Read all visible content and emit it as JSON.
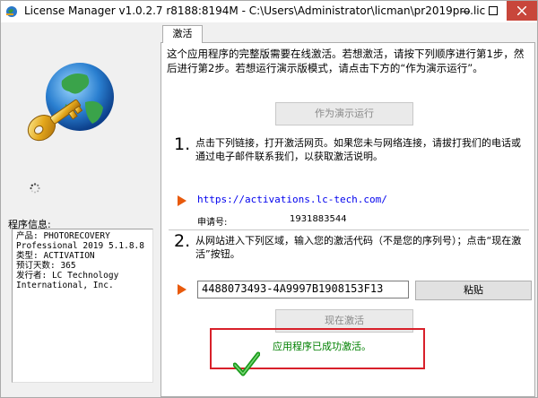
{
  "window": {
    "title": "License Manager v1.0.2.7 r8188:8194M - C:\\Users\\Administrator\\licman\\pr2019pro.lic",
    "controls": [
      "minimize",
      "maximize",
      "close"
    ]
  },
  "left": {
    "logo_icon": "globe-key-icon",
    "info_label": "程序信息:",
    "info_text": "产品: PHOTORECOVERY\nProfessional 2019 5.1.8.8\n类型: ACTIVATION\n预订天数: 365\n发行者: LC Technology\nInternational, Inc."
  },
  "tab": {
    "label": "激活"
  },
  "intro": "这个应用程序的完整版需要在线激活。若想激活，请按下列顺序进行第1步，然后进行第2步。若想运行演示版模式，请点击下方的“作为演示运行”。",
  "demo_button": "作为演示运行",
  "step1": {
    "number": "1.",
    "text": "点击下列链接，打开激活网页。如果您未与网络连接，请拔打我们的电话或通过电子邮件联系我们，以获取激活说明。",
    "link": "https://activations.lc-tech.com/",
    "request_label": "申请号:",
    "request_value": "1931883544"
  },
  "step2": {
    "number": "2.",
    "text": "从网站进入下列区域，输入您的激活代码（不是您的序列号）；点击“现在激活”按钮。",
    "code_value": "4488073493-4A9997B1908153F13",
    "paste_button": "粘贴",
    "activate_button": "现在激活"
  },
  "status": {
    "message": "应用程序已成功激活。",
    "icon": "checkmark-icon",
    "color": "#008000",
    "box_color": "#d8202a"
  }
}
